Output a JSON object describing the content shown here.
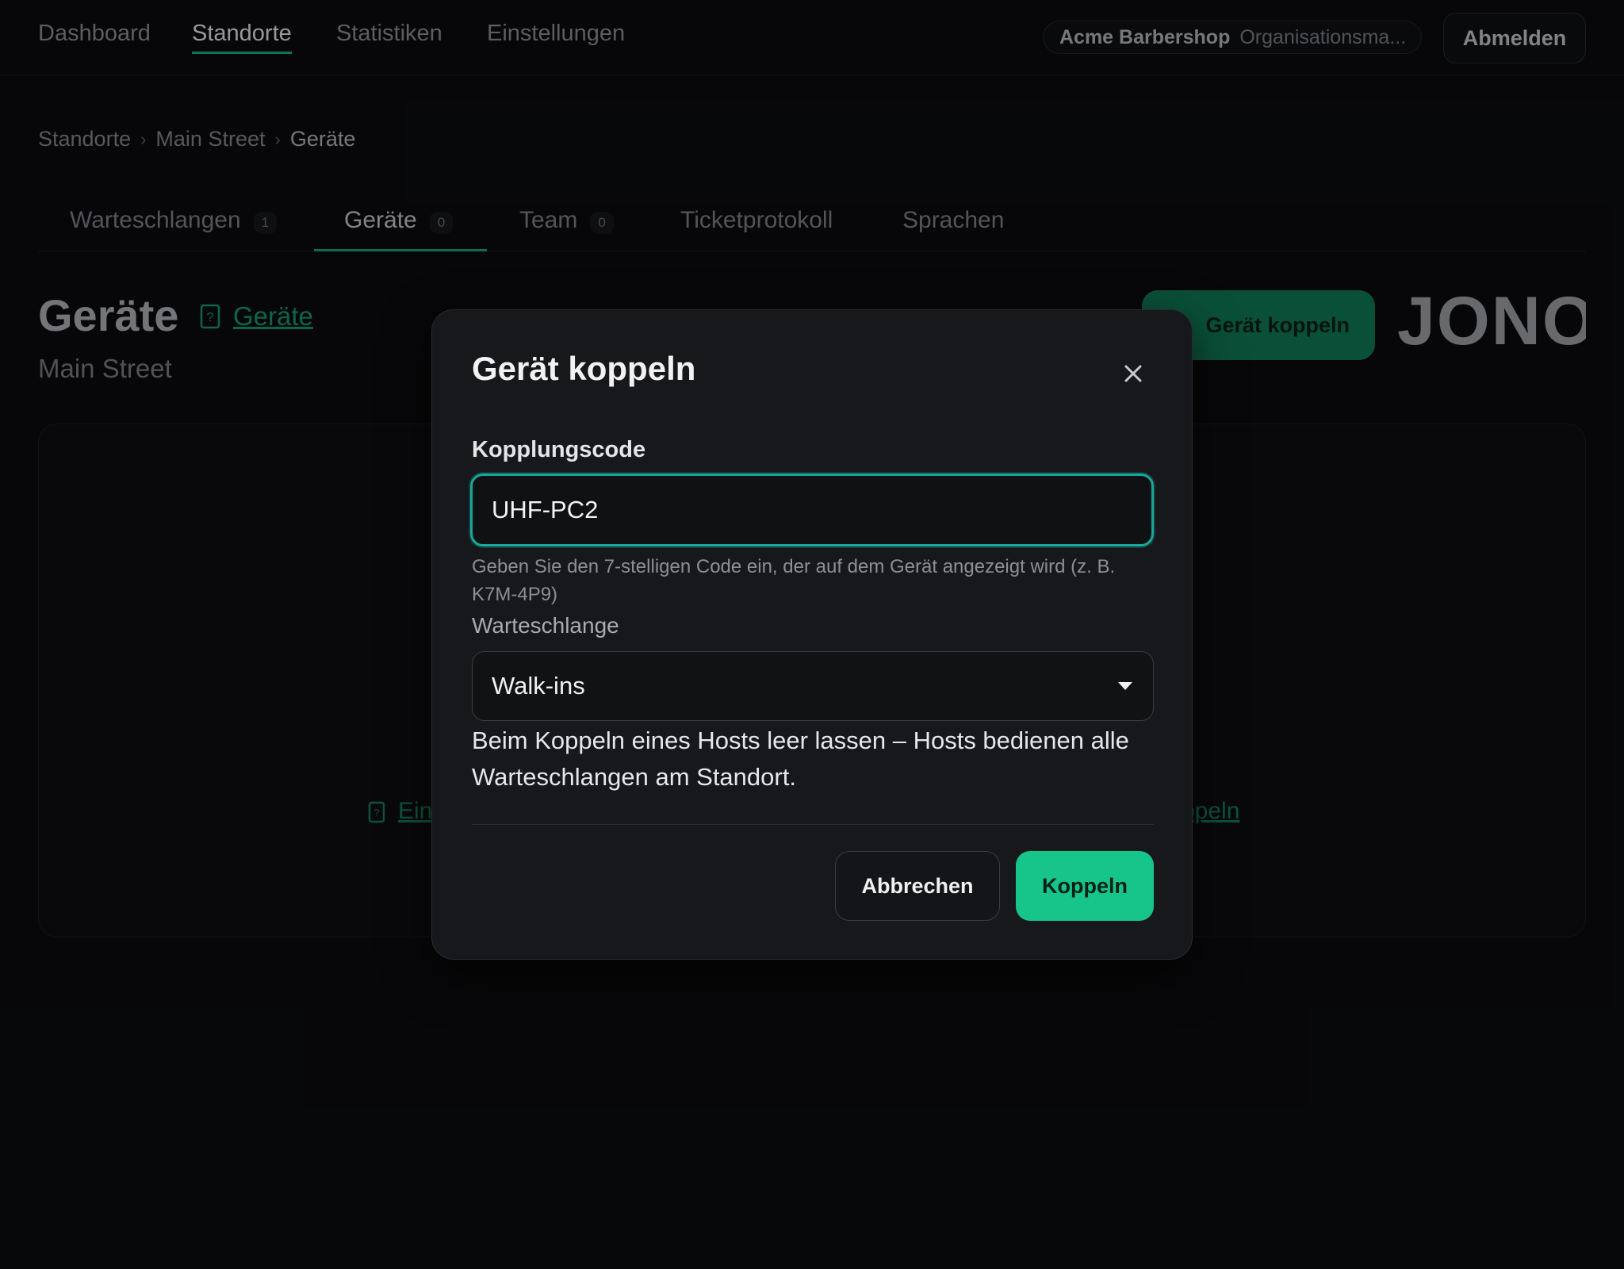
{
  "nav": {
    "items": [
      {
        "label": "Dashboard"
      },
      {
        "label": "Standorte"
      },
      {
        "label": "Statistiken"
      },
      {
        "label": "Einstellungen"
      }
    ],
    "active": "Standorte",
    "org_name": "Acme Barbershop",
    "org_role": "Organisationsma...",
    "logout_label": "Abmelden"
  },
  "breadcrumb": [
    "Standorte",
    "Main Street",
    "Geräte"
  ],
  "tabs": [
    {
      "label": "Warteschlangen",
      "count": "1"
    },
    {
      "label": "Geräte",
      "count": "0"
    },
    {
      "label": "Team",
      "count": "0"
    },
    {
      "label": "Ticketprotokoll"
    },
    {
      "label": "Sprachen"
    }
  ],
  "active_tab": "Geräte",
  "page": {
    "title": "Geräte",
    "help_link": "Geräte",
    "subtitle": "Main Street",
    "pair_button": "Gerät koppeln",
    "logo_text": "JONOT",
    "empty_left_link": "Ein",
    "empty_right_link": "ppeln"
  },
  "modal": {
    "title": "Gerät koppeln",
    "code_label": "Kopplungscode",
    "code_value": "UHF-PC2",
    "code_hint": "Geben Sie den 7-stelligen Code ein, der auf dem Gerät angezeigt wird (z. B. K7M-4P9)",
    "queue_label": "Warteschlange",
    "queue_value": "Walk-ins",
    "queue_help": "Beim Koppeln eines Hosts leer lassen – Hosts bedienen alle Warteschlangen am Standort.",
    "cancel_label": "Abbrechen",
    "submit_label": "Koppeln"
  },
  "colors": {
    "accent": "#17c58b",
    "focus_ring": "#16a899",
    "background": "#0b0c0e",
    "modal_bg": "#17181b"
  }
}
